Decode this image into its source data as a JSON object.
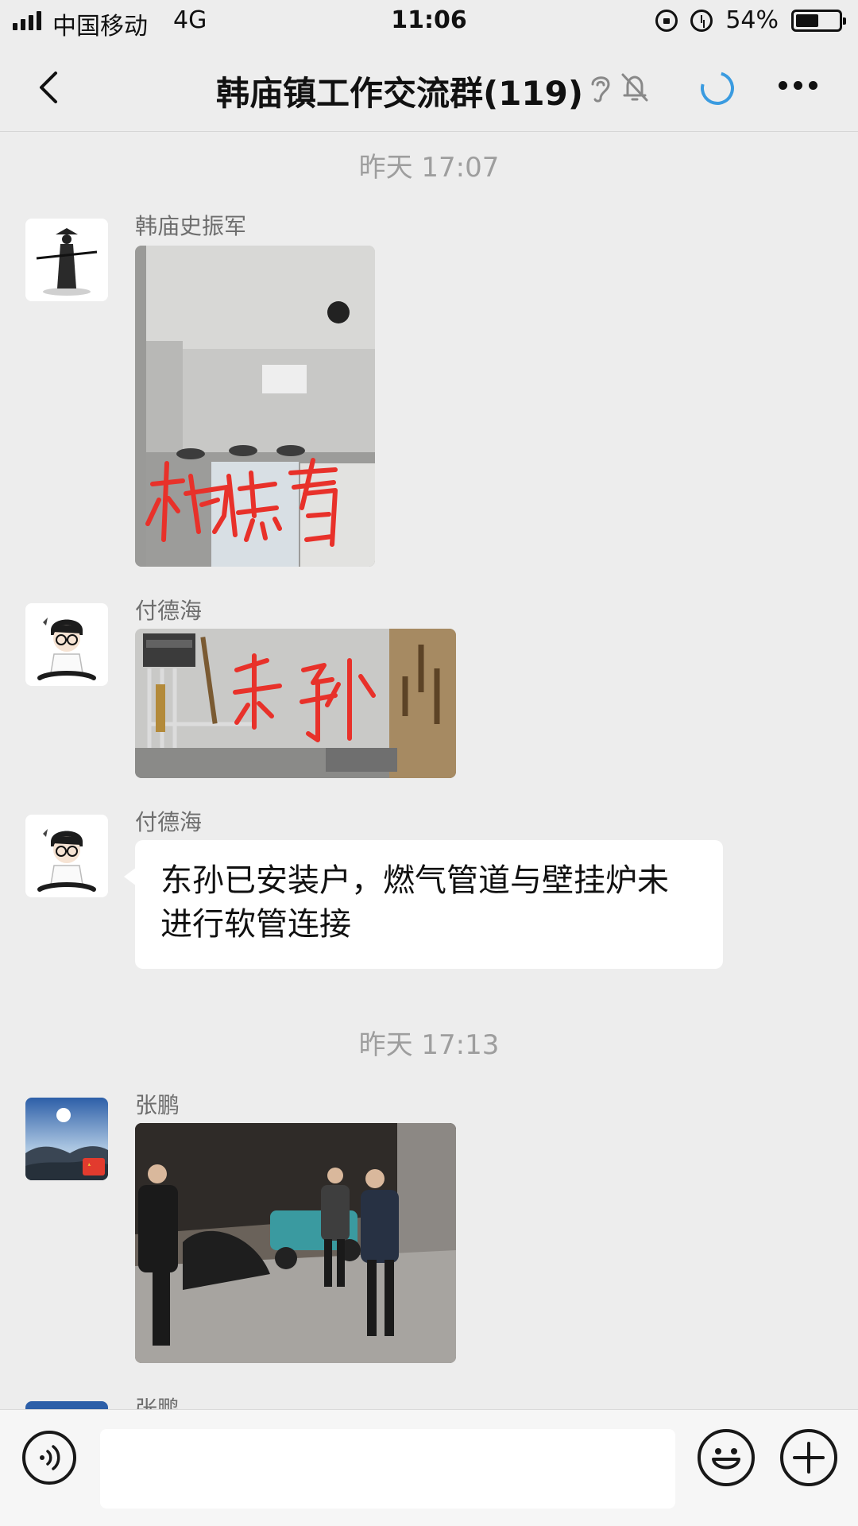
{
  "status_bar": {
    "carrier": "中国移动",
    "network": "4G",
    "time": "11:06",
    "battery": "54%",
    "battery_level": 0.54,
    "icons": [
      "signal-icon",
      "rotation-lock-icon",
      "alarm-icon",
      "battery-icon"
    ]
  },
  "nav": {
    "title": "韩庙镇工作交流群(119)",
    "icons": [
      "back-icon",
      "earpiece-icon",
      "bell-off-icon",
      "loading-icon",
      "more-icon"
    ]
  },
  "messages": [
    {
      "type": "time",
      "text": "昨天 17:07"
    },
    {
      "type": "image",
      "sender": "韩庙史振军",
      "handwriting": "杨志春"
    },
    {
      "type": "image",
      "sender": "付德海",
      "handwriting": "东孙"
    },
    {
      "type": "text",
      "sender": "付德海",
      "text": "东孙已安装户，燃气管道与壁挂炉未进行软管连接"
    },
    {
      "type": "time",
      "text": "昨天 17:13"
    },
    {
      "type": "image",
      "sender": "张鹏"
    },
    {
      "type": "image",
      "sender": "张鹏"
    }
  ],
  "input_bar": {
    "placeholder": "",
    "icons": [
      "voice-icon",
      "emoji-icon",
      "plus-icon"
    ]
  },
  "colors": {
    "background": "#ededed",
    "bubble": "#ffffff",
    "accent_loading": "#3a9be0",
    "handwriting_red": "#e8312a"
  }
}
